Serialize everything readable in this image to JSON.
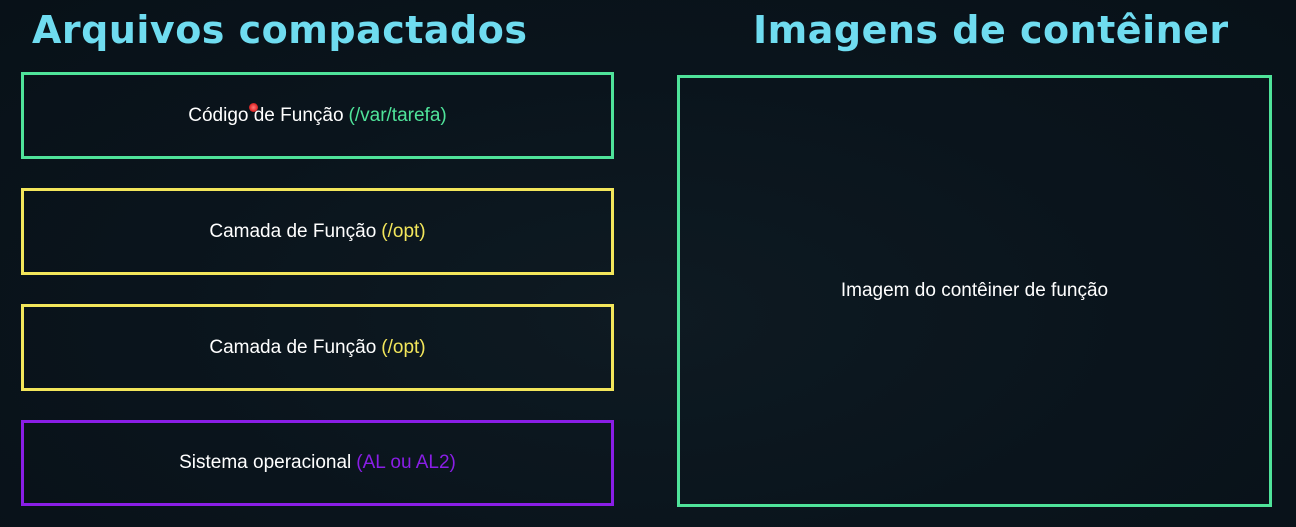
{
  "headings": {
    "left": "Arquivos compactados",
    "right": "Imagens de contêiner"
  },
  "colors": {
    "background": "#0a141c",
    "heading": "#6fdcf0",
    "green": "#4fe39a",
    "yellow": "#f3e65b",
    "purple": "#8a1ee6",
    "text": "#ffffff"
  },
  "zip_layers": [
    {
      "label": "Código de Função",
      "path": "(/var/tarefa)",
      "color": "#4fe39a"
    },
    {
      "label": "Camada de Função",
      "path": "(/opt)",
      "color": "#f3e65b"
    },
    {
      "label": "Camada de Função",
      "path": "(/opt)",
      "color": "#f3e65b"
    },
    {
      "label": "Sistema operacional",
      "path": "(AL ou AL2)",
      "color": "#8a1ee6"
    }
  ],
  "container": {
    "label": "Imagem do contêiner de função"
  }
}
